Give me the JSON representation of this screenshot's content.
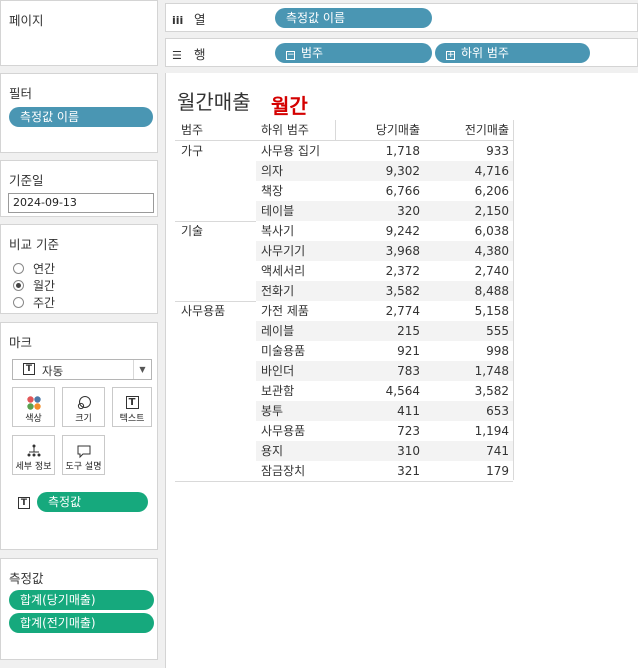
{
  "left_panel": {
    "pages": {
      "title": "페이지"
    },
    "filters": {
      "title": "필터",
      "pills": [
        "측정값 이름"
      ]
    },
    "base_date": {
      "title": "기준일",
      "value": "2024-09-13"
    },
    "compare": {
      "title": "비교 기준",
      "options": [
        "연간",
        "월간",
        "주간"
      ],
      "selected": "월간"
    },
    "marks": {
      "title": "마크",
      "type_label": "자동",
      "buttons": [
        {
          "label": "색상",
          "icon": "color-icon"
        },
        {
          "label": "크기",
          "icon": "size-icon"
        },
        {
          "label": "텍스트",
          "icon": "text-icon"
        },
        {
          "label": "세부 정보",
          "icon": "detail-icon"
        },
        {
          "label": "도구 설명",
          "icon": "tooltip-icon"
        }
      ],
      "text_pill": "측정값"
    },
    "measures": {
      "title": "측정값",
      "pills": [
        "합계(당기매출)",
        "합계(전기매출)"
      ]
    }
  },
  "shelves": {
    "columns": {
      "label": "열",
      "pills": [
        "측정값 이름"
      ]
    },
    "rows": {
      "label": "행",
      "pills": [
        "범주",
        "하위 범주"
      ]
    }
  },
  "view": {
    "title": "월간매출",
    "subtitle": "월간",
    "headers": [
      "범주",
      "하위 범주",
      "당기매출",
      "전기매출"
    ],
    "groups": [
      {
        "category": "가구",
        "rows": [
          [
            "사무용 집기",
            "1,718",
            "933"
          ],
          [
            "의자",
            "9,302",
            "4,716"
          ],
          [
            "책장",
            "6,766",
            "6,206"
          ],
          [
            "테이블",
            "320",
            "2,150"
          ]
        ]
      },
      {
        "category": "기술",
        "rows": [
          [
            "복사기",
            "9,242",
            "6,038"
          ],
          [
            "사무기기",
            "3,968",
            "4,380"
          ],
          [
            "액세서리",
            "2,372",
            "2,740"
          ],
          [
            "전화기",
            "3,582",
            "8,488"
          ]
        ]
      },
      {
        "category": "사무용품",
        "rows": [
          [
            "가전 제품",
            "2,774",
            "5,158"
          ],
          [
            "레이블",
            "215",
            "555"
          ],
          [
            "미술용품",
            "921",
            "998"
          ],
          [
            "바인더",
            "783",
            "1,748"
          ],
          [
            "보관함",
            "4,564",
            "3,582"
          ],
          [
            "봉투",
            "411",
            "653"
          ],
          [
            "사무용품",
            "723",
            "1,194"
          ],
          [
            "용지",
            "310",
            "741"
          ],
          [
            "잠금장치",
            "321",
            "179"
          ]
        ]
      }
    ]
  },
  "colors": {
    "pill_blue": "#4a96b3",
    "pill_green": "#16a97d",
    "subtitle_red": "#d40000"
  }
}
